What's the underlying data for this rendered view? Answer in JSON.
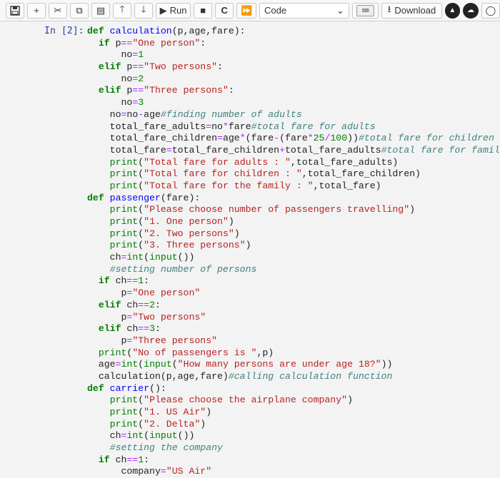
{
  "toolbar": {
    "run_label": "Run",
    "cell_type": "Code",
    "download_label": "Download"
  },
  "cell": {
    "prompt": "In [2]:",
    "lines": [
      [
        [
          "kw",
          "def "
        ],
        [
          "fn",
          "calculation"
        ],
        [
          "",
          "(p,age,fare):"
        ]
      ],
      [
        [
          "",
          "  "
        ],
        [
          "kw",
          "if "
        ],
        [
          "",
          "p"
        ],
        [
          "op",
          "=="
        ],
        [
          "str",
          "\"One person\""
        ],
        [
          "",
          ":"
        ]
      ],
      [
        [
          "",
          "      no"
        ],
        [
          "op",
          "="
        ],
        [
          "num",
          "1"
        ]
      ],
      [
        [
          "",
          "  "
        ],
        [
          "kw",
          "elif "
        ],
        [
          "",
          "p"
        ],
        [
          "op",
          "=="
        ],
        [
          "str",
          "\"Two persons\""
        ],
        [
          "",
          ":"
        ]
      ],
      [
        [
          "",
          "      no"
        ],
        [
          "op",
          "="
        ],
        [
          "num",
          "2"
        ]
      ],
      [
        [
          "",
          "  "
        ],
        [
          "kw",
          "elif "
        ],
        [
          "",
          "p"
        ],
        [
          "op",
          "=="
        ],
        [
          "str",
          "\"Three persons\""
        ],
        [
          "",
          ":"
        ]
      ],
      [
        [
          "",
          "      no"
        ],
        [
          "op",
          "="
        ],
        [
          "num",
          "3"
        ]
      ],
      [
        [
          "",
          "    no"
        ],
        [
          "op",
          "="
        ],
        [
          "",
          "no"
        ],
        [
          "op",
          "-"
        ],
        [
          "",
          "age"
        ],
        [
          "cm",
          "#finding number of adults"
        ]
      ],
      [
        [
          "",
          "    total_fare_adults"
        ],
        [
          "op",
          "="
        ],
        [
          "",
          "no"
        ],
        [
          "op",
          "*"
        ],
        [
          "",
          "fare"
        ],
        [
          "cm",
          "#total fare for adults"
        ]
      ],
      [
        [
          "",
          "    total_fare_children"
        ],
        [
          "op",
          "="
        ],
        [
          "",
          "age"
        ],
        [
          "op",
          "*"
        ],
        [
          "",
          "(fare"
        ],
        [
          "op",
          "-"
        ],
        [
          "",
          "(fare"
        ],
        [
          "op",
          "*"
        ],
        [
          "num",
          "25"
        ],
        [
          "op",
          "/"
        ],
        [
          "num",
          "100"
        ],
        [
          "",
          "))"
        ],
        [
          "cm",
          "#total fare for children"
        ]
      ],
      [
        [
          "",
          "    total_fare"
        ],
        [
          "op",
          "="
        ],
        [
          "",
          "total_fare_children"
        ],
        [
          "op",
          "+"
        ],
        [
          "",
          "total_fare_adults"
        ],
        [
          "cm",
          "#total fare for family"
        ]
      ],
      [
        [
          "",
          "    "
        ],
        [
          "bi",
          "print"
        ],
        [
          "",
          "("
        ],
        [
          "str",
          "\"Total fare for adults : \""
        ],
        [
          "",
          ",total_fare_adults)"
        ]
      ],
      [
        [
          "",
          "    "
        ],
        [
          "bi",
          "print"
        ],
        [
          "",
          "("
        ],
        [
          "str",
          "\"Total fare for children : \""
        ],
        [
          "",
          ",total_fare_children)"
        ]
      ],
      [
        [
          "",
          "    "
        ],
        [
          "bi",
          "print"
        ],
        [
          "",
          "("
        ],
        [
          "str",
          "\"Total fare for the family : \""
        ],
        [
          "",
          ",total_fare)"
        ]
      ],
      [
        [
          "kw",
          "def "
        ],
        [
          "fn",
          "passenger"
        ],
        [
          "",
          "(fare):"
        ]
      ],
      [
        [
          "",
          "    "
        ],
        [
          "bi",
          "print"
        ],
        [
          "",
          "("
        ],
        [
          "str",
          "\"Please choose number of passengers travelling\""
        ],
        [
          "",
          ")"
        ]
      ],
      [
        [
          "",
          "    "
        ],
        [
          "bi",
          "print"
        ],
        [
          "",
          "("
        ],
        [
          "str",
          "\"1. One person\""
        ],
        [
          "",
          ")"
        ]
      ],
      [
        [
          "",
          "    "
        ],
        [
          "bi",
          "print"
        ],
        [
          "",
          "("
        ],
        [
          "str",
          "\"2. Two persons\""
        ],
        [
          "",
          ")"
        ]
      ],
      [
        [
          "",
          "    "
        ],
        [
          "bi",
          "print"
        ],
        [
          "",
          "("
        ],
        [
          "str",
          "\"3. Three persons\""
        ],
        [
          "",
          ")"
        ]
      ],
      [
        [
          "",
          "    ch"
        ],
        [
          "op",
          "="
        ],
        [
          "bi",
          "int"
        ],
        [
          "",
          "("
        ],
        [
          "bi",
          "input"
        ],
        [
          "",
          "())"
        ]
      ],
      [
        [
          "cm",
          "    #setting number of persons"
        ]
      ],
      [
        [
          "",
          "  "
        ],
        [
          "kw",
          "if "
        ],
        [
          "",
          "ch"
        ],
        [
          "op",
          "=="
        ],
        [
          "num",
          "1"
        ],
        [
          "",
          ":"
        ]
      ],
      [
        [
          "",
          "      p"
        ],
        [
          "op",
          "="
        ],
        [
          "str",
          "\"One person\""
        ]
      ],
      [
        [
          "",
          "  "
        ],
        [
          "kw",
          "elif "
        ],
        [
          "",
          "ch"
        ],
        [
          "op",
          "=="
        ],
        [
          "num",
          "2"
        ],
        [
          "",
          ":"
        ]
      ],
      [
        [
          "",
          "      p"
        ],
        [
          "op",
          "="
        ],
        [
          "str",
          "\"Two persons\""
        ]
      ],
      [
        [
          "",
          "  "
        ],
        [
          "kw",
          "elif "
        ],
        [
          "",
          "ch"
        ],
        [
          "op",
          "=="
        ],
        [
          "num",
          "3"
        ],
        [
          "",
          ":"
        ]
      ],
      [
        [
          "",
          "      p"
        ],
        [
          "op",
          "="
        ],
        [
          "str",
          "\"Three persons\""
        ]
      ],
      [
        [
          "",
          "  "
        ],
        [
          "bi",
          "print"
        ],
        [
          "",
          "("
        ],
        [
          "str",
          "\"No of passengers is \""
        ],
        [
          "",
          ",p)"
        ]
      ],
      [
        [
          "",
          "  age"
        ],
        [
          "op",
          "="
        ],
        [
          "bi",
          "int"
        ],
        [
          "",
          "("
        ],
        [
          "bi",
          "input"
        ],
        [
          "",
          "("
        ],
        [
          "str",
          "\"How many persons are under age 18?\""
        ],
        [
          "",
          "))"
        ]
      ],
      [
        [
          "",
          "  calculation(p,age,fare)"
        ],
        [
          "cm",
          "#calling calculation function"
        ]
      ],
      [
        [
          "kw",
          "def "
        ],
        [
          "fn",
          "carrier"
        ],
        [
          "",
          "():"
        ]
      ],
      [
        [
          "",
          "    "
        ],
        [
          "bi",
          "print"
        ],
        [
          "",
          "("
        ],
        [
          "str",
          "\"Please choose the airplane company\""
        ],
        [
          "",
          ")"
        ]
      ],
      [
        [
          "",
          "    "
        ],
        [
          "bi",
          "print"
        ],
        [
          "",
          "("
        ],
        [
          "str",
          "\"1. US Air\""
        ],
        [
          "",
          ")"
        ]
      ],
      [
        [
          "",
          "    "
        ],
        [
          "bi",
          "print"
        ],
        [
          "",
          "("
        ],
        [
          "str",
          "\"2. Delta\""
        ],
        [
          "",
          ")"
        ]
      ],
      [
        [
          "",
          "    ch"
        ],
        [
          "op",
          "="
        ],
        [
          "bi",
          "int"
        ],
        [
          "",
          "("
        ],
        [
          "bi",
          "input"
        ],
        [
          "",
          "())"
        ]
      ],
      [
        [
          "cm",
          "    #setting the company"
        ]
      ],
      [
        [
          "",
          "  "
        ],
        [
          "kw",
          "if "
        ],
        [
          "",
          "ch"
        ],
        [
          "op",
          "=="
        ],
        [
          "num",
          "1"
        ],
        [
          "",
          ":"
        ]
      ],
      [
        [
          "",
          "      company"
        ],
        [
          "op",
          "="
        ],
        [
          "str",
          "\"US Air\""
        ]
      ]
    ]
  }
}
